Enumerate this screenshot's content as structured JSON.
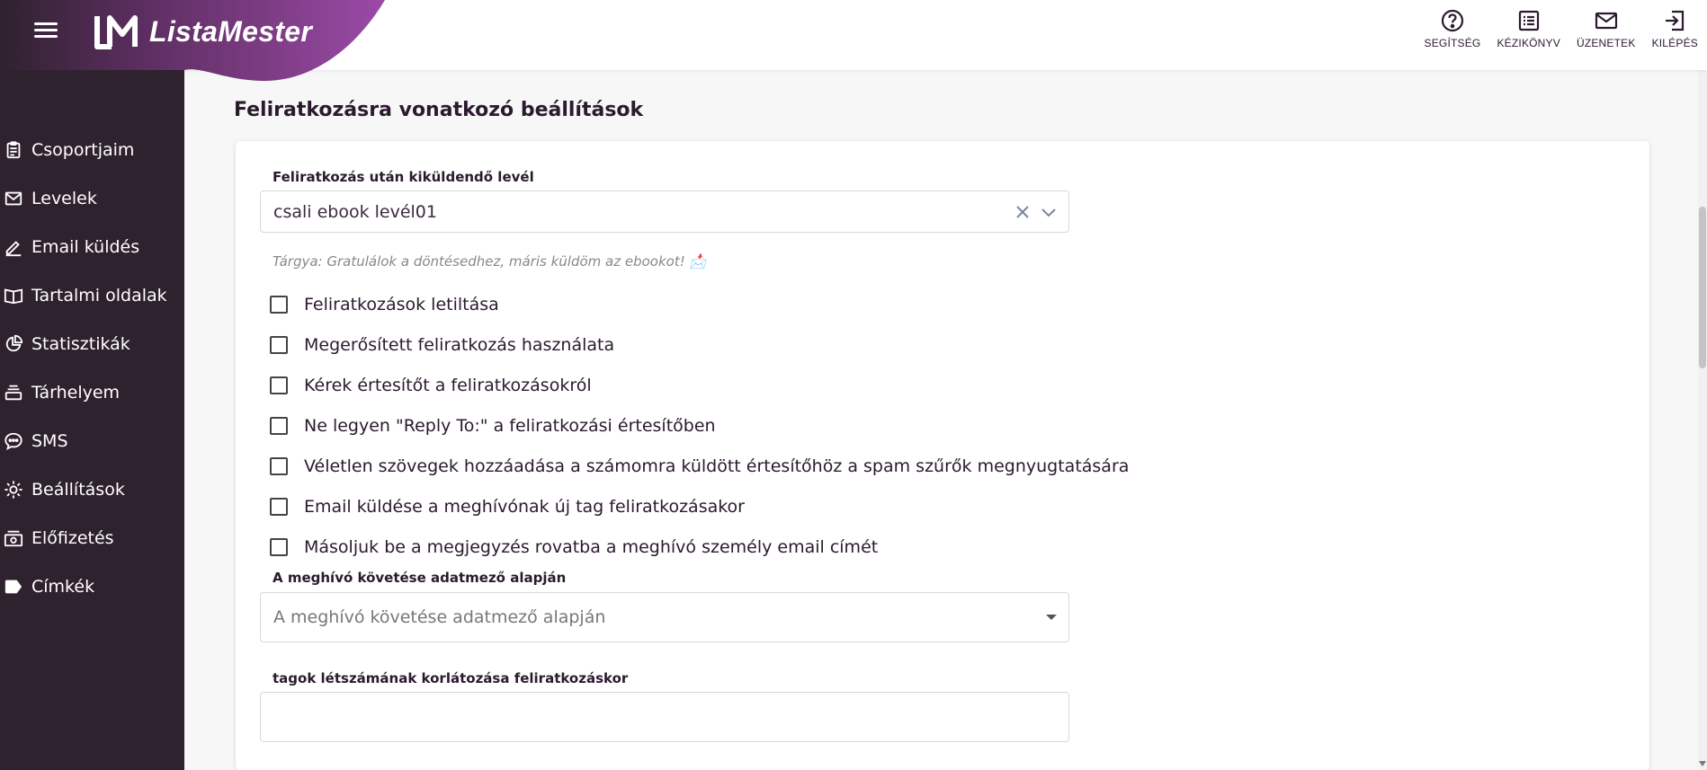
{
  "app": {
    "name": "ListaMester"
  },
  "colors": {
    "brand_dark": "#2f222f",
    "brand_purple": "#9b4aa6",
    "text": "#2b1a2e"
  },
  "sidebar": {
    "items": [
      {
        "label": "Csoportjaim",
        "icon": "clipboard-icon"
      },
      {
        "label": "Levelek",
        "icon": "mail-icon"
      },
      {
        "label": "Email küldés",
        "icon": "pencil-icon"
      },
      {
        "label": "Tartalmi oldalak",
        "icon": "book-icon"
      },
      {
        "label": "Statisztikák",
        "icon": "pie-chart-icon"
      },
      {
        "label": "Tárhelyem",
        "icon": "storage-icon"
      },
      {
        "label": "SMS",
        "icon": "chat-icon"
      },
      {
        "label": "Beállítások",
        "icon": "gear-icon"
      },
      {
        "label": "Előfizetés",
        "icon": "subscription-icon"
      },
      {
        "label": "Címkék",
        "icon": "tag-icon"
      }
    ]
  },
  "topbar": {
    "help": "SEGÍTSÉG",
    "manual": "KÉZIKÖNYV",
    "messages": "ÜZENETEK",
    "logout": "KILÉPÉS"
  },
  "main": {
    "title": "Feliratkozásra vonatkozó beállítások",
    "letter_field": {
      "label": "Feliratkozás után kiküldendő levél",
      "value": "csali ebook levél01",
      "subject": "Tárgya: Gratulálok a döntésedhez, máris küldöm az ebookot! 📩"
    },
    "checkboxes": [
      {
        "label": "Feliratkozások letiltása",
        "checked": false
      },
      {
        "label": "Megerősített feliratkozás használata",
        "checked": false
      },
      {
        "label": "Kérek értesítőt a feliratkozásokról",
        "checked": false
      },
      {
        "label": "Ne legyen \"Reply To:\" a feliratkozási értesítőben",
        "checked": false
      },
      {
        "label": "Véletlen szövegek hozzáadása a számomra küldött értesítőhöz a spam szűrők megnyugtatására",
        "checked": false
      },
      {
        "label": "Email küldése a meghívónak új tag feliratkozásakor",
        "checked": false
      },
      {
        "label": "Másoljuk be a megjegyzés rovatba a meghívó személy email címét",
        "checked": false
      }
    ],
    "inviter_field": {
      "label": "A meghívó követése adatmező alapján",
      "placeholder": "A meghívó követése adatmező alapján"
    },
    "limit_field": {
      "label": "tagok létszámának korlátozása feliratkozáskor",
      "value": ""
    }
  }
}
